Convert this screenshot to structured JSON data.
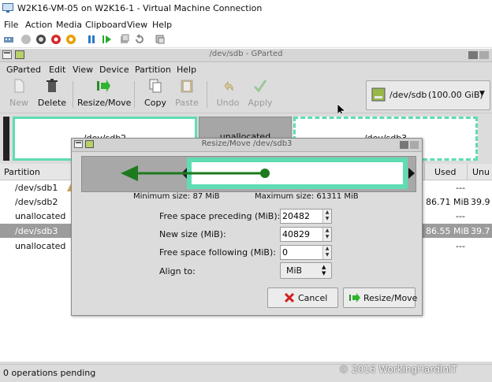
{
  "window": {
    "title": "W2K16-VM-05 on W2K16-1 - Virtual Machine Connection"
  },
  "vm_menu": [
    "File",
    "Action",
    "Media",
    "Clipboard",
    "View",
    "Help"
  ],
  "gparted": {
    "title": "/dev/sdb - GParted",
    "menu": [
      "GParted",
      "Edit",
      "View",
      "Device",
      "Partition",
      "Help"
    ],
    "toolbar": {
      "new": "New",
      "delete": "Delete",
      "resize_move": "Resize/Move",
      "copy": "Copy",
      "paste": "Paste",
      "undo": "Undo",
      "apply": "Apply"
    },
    "device": {
      "name": "/dev/sdb",
      "size": "(100.00 GiB)"
    },
    "map": {
      "p1": "/dev/sdb2",
      "p2": "unallocated",
      "p3": "/dev/sdb3"
    },
    "table": {
      "headers": {
        "partition": "Partition",
        "used": "Used",
        "unused": "Unu"
      },
      "rows": [
        {
          "partition": "/dev/sdb1",
          "used": "---",
          "unused": ""
        },
        {
          "partition": "/dev/sdb2",
          "used": "86.71 MiB",
          "unused": "39.9"
        },
        {
          "partition": "unallocated",
          "used": "---",
          "unused": ""
        },
        {
          "partition": "/dev/sdb3",
          "used": "86.55 MiB",
          "unused": "39.7"
        },
        {
          "partition": "unallocated",
          "used": "---",
          "unused": ""
        }
      ]
    },
    "status": "0 operations pending"
  },
  "dialog": {
    "title": "Resize/Move /dev/sdb3",
    "min_size": "Minimum size: 87 MiB",
    "max_size": "Maximum size: 61311 MiB",
    "fields": {
      "preceding_label": "Free space preceding (MiB):",
      "preceding_value": "20482",
      "newsize_label": "New size (MiB):",
      "newsize_value": "40829",
      "following_label": "Free space following (MiB):",
      "following_value": "0",
      "align_label": "Align to:",
      "align_value": "MiB"
    },
    "buttons": {
      "cancel": "Cancel",
      "resize": "Resize/Move"
    }
  },
  "watermark": "© 2016 WorkingHardInIT",
  "colors": {
    "partition_border": "#5fdcb4",
    "arrow": "#1e7a1e"
  }
}
